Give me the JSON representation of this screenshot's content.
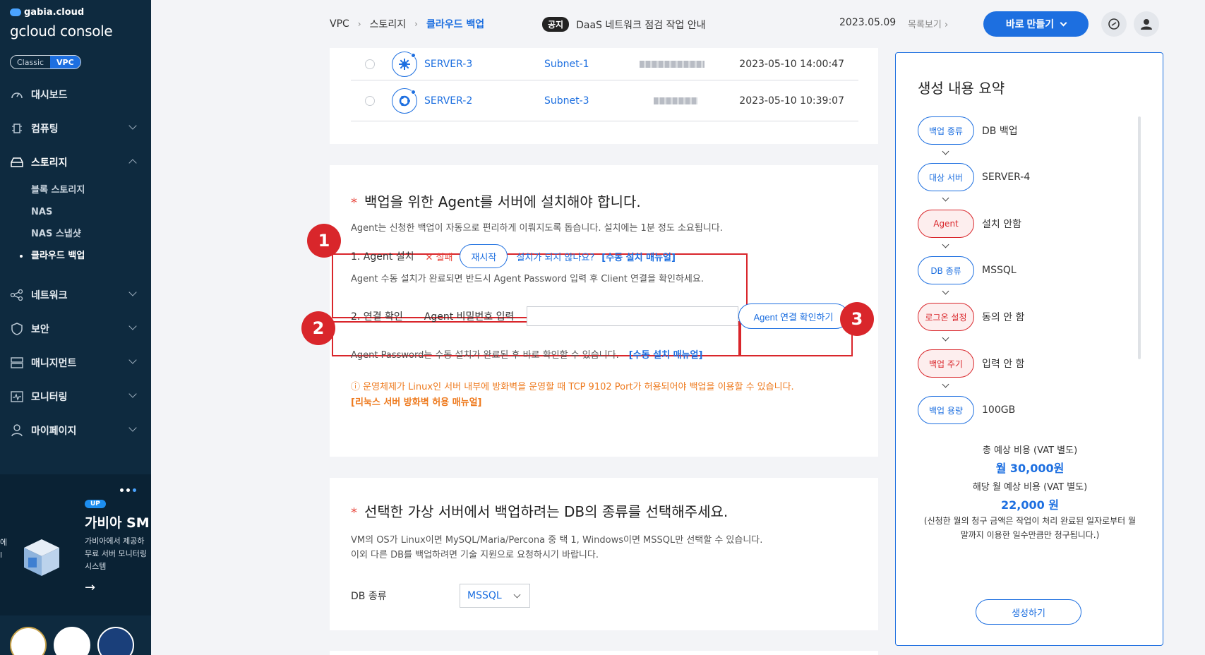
{
  "sidebar": {
    "brand_small": "gabia.cloud",
    "brand_main": "gcloud console",
    "mode_classic": "Classic",
    "mode_vpc": "VPC",
    "items": [
      {
        "label": "대시보드"
      },
      {
        "label": "컴퓨팅"
      },
      {
        "label": "스토리지"
      },
      {
        "label": "네트워크"
      },
      {
        "label": "보안"
      },
      {
        "label": "매니지먼트"
      },
      {
        "label": "모니터링"
      },
      {
        "label": "마이페이지"
      }
    ],
    "storage_sub": [
      "블록 스토리지",
      "NAS",
      "NAS 스냅샷",
      "클라우드 백업"
    ],
    "promo": {
      "badge": "UP",
      "title": "가비아 SM",
      "desc1": "가비아에서 제공하",
      "desc2": "무료 서버 모니터링",
      "desc3": "시스템",
      "left1": "에",
      "left2": "l"
    }
  },
  "topbar": {
    "crumbs": [
      "VPC",
      "스토리지",
      "클라우드 백업"
    ],
    "notice_tag": "공지",
    "notice_text": "DaaS 네트워크 점검 작업 안내",
    "notice_date": "2023.05.09",
    "notice_list": "목록보기",
    "make_label": "바로 만들기"
  },
  "servers": [
    {
      "name": "SERVER-3",
      "subnet": "Subnet-1",
      "created": "2023-05-10 14:00:47"
    },
    {
      "name": "SERVER-2",
      "subnet": "Subnet-3",
      "created": "2023-05-10 10:39:07"
    }
  ],
  "agent": {
    "title": "백업을 위한 Agent를 서버에 설치해야 합니다.",
    "desc": "Agent는 신청한 백업이 자동으로 편리하게 이뤄지도록 돕습니다. 설치에는 1분 정도 소요됩니다.",
    "install_label": "1. Agent 설치",
    "fail": "✕ 실패",
    "restart": "재시작",
    "help_q": "설치가 되지 않나요?",
    "help_link": "[수동 설치 매뉴얼]",
    "install_note": "Agent 수동 설치가 완료되면 반드시 Agent Password 입력 후 Client 연결을 확인하세요.",
    "conn_label": "2. 연결 확인",
    "pwd_label": "Agent 비밀번호 입력",
    "pwd_value": "",
    "conn_btn": "Agent 연결 확인하기",
    "pw_note": "Agent Password는 수동 설치가 완료된 후 바로 확인할 수 있습니다.",
    "pw_link": "[수동 설치 매뉴얼]",
    "warn": "ⓘ 운영체제가 Linux인 서버 내부에 방화벽을 운영할 때 TCP 9102 Port가 허용되어야 백업을 이용할 수 있습니다.",
    "warn_link": "[리눅스 서버 방화벽 허용 매뉴얼]",
    "marker1": "1",
    "marker2": "2",
    "marker3": "3"
  },
  "db": {
    "title": "선택한 가상 서버에서 백업하려는 DB의 종류를 선택해주세요.",
    "desc1": "VM의 OS가 Linux이면 MySQL/Maria/Percona 중 택 1, Windows이면 MSSQL만 선택할 수 있습니다.",
    "desc2": "이외 다른 DB를 백업하려면 기술 지원으로 요청하시기 바랍니다.",
    "label": "DB 종류",
    "selected": "MSSQL"
  },
  "summary": {
    "title": "생성 내용 요약",
    "steps": [
      {
        "pill": "백업 종류",
        "value": "DB 백업",
        "state": "ok"
      },
      {
        "pill": "대상 서버",
        "value": "SERVER-4",
        "state": "ok"
      },
      {
        "pill": "Agent",
        "value": "설치 안함",
        "state": "error"
      },
      {
        "pill": "DB 종류",
        "value": "MSSQL",
        "state": "ok"
      },
      {
        "pill": "로그온 설정",
        "value": "동의 안 함",
        "state": "error"
      },
      {
        "pill": "백업 주기",
        "value": "입력 안 함",
        "state": "error"
      },
      {
        "pill": "백업 용량",
        "value": "100GB",
        "state": "ok"
      }
    ],
    "total_label": "총 예상 비용 (VAT 별도)",
    "total_value": "월 30,000원",
    "month_label": "해당 월 예상 비용 (VAT 별도)",
    "month_value": "22,000 원",
    "note1": "(신청한 월의 청구 금액은 작업이 처리 완료된 일자로부터 월",
    "note2": "말까지 이용한 일수만큼만 청구됩니다.)",
    "create": "생성하기"
  },
  "colors": {
    "accent": "#1d6fe0",
    "error": "#d9262b",
    "warning": "#ee7a1e",
    "sidebar": "#0e2a3f"
  }
}
